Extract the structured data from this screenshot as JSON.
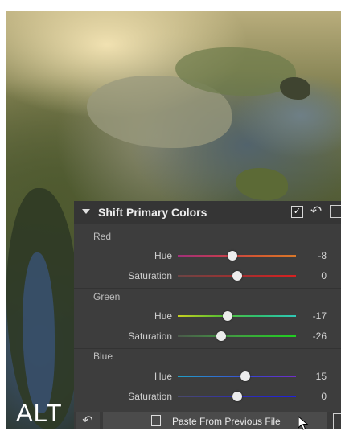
{
  "overlay": {
    "label": "ALT"
  },
  "panel": {
    "title": "Shift Primary Colors",
    "enabled": true,
    "groups": [
      {
        "name": "Red",
        "rows": [
          {
            "label": "Hue",
            "value": "-8",
            "knob_fraction": 0.46
          },
          {
            "label": "Saturation",
            "value": "0",
            "knob_fraction": 0.5
          }
        ]
      },
      {
        "name": "Green",
        "rows": [
          {
            "label": "Hue",
            "value": "-17",
            "knob_fraction": 0.42
          },
          {
            "label": "Saturation",
            "value": "-26",
            "knob_fraction": 0.37
          }
        ]
      },
      {
        "name": "Blue",
        "rows": [
          {
            "label": "Hue",
            "value": "15",
            "knob_fraction": 0.57
          },
          {
            "label": "Saturation",
            "value": "0",
            "knob_fraction": 0.5
          }
        ]
      }
    ]
  },
  "footer": {
    "paste_label": "Paste From Previous File"
  },
  "icons": [
    "undo-icon",
    "checkbox-icon",
    "copy-settings-icon",
    "paste-icon",
    "mouse-cursor-icon"
  ]
}
